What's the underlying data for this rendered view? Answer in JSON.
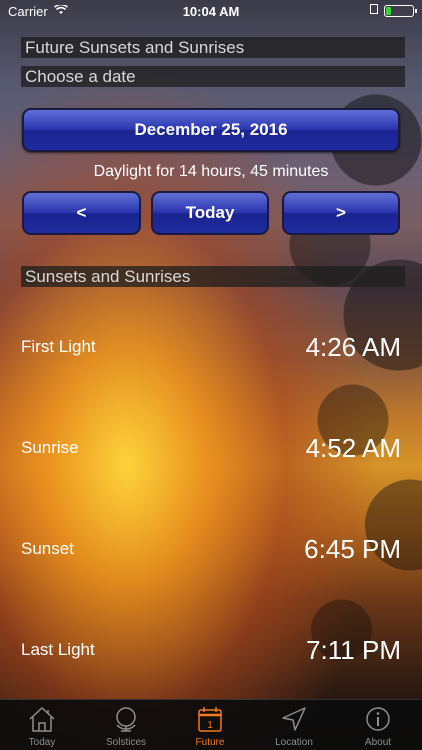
{
  "status": {
    "carrier": "Carrier",
    "time": "10:04 AM",
    "battery_level": 0.2
  },
  "headers": {
    "future": "Future Sunsets and Sunrises",
    "choose_date": "Choose a date",
    "sunsets": "Sunsets and Sunrises"
  },
  "date_button": "December 25, 2016",
  "daylight": "Daylight for 14 hours, 45 minutes",
  "nav": {
    "prev": "<",
    "today": "Today",
    "next": ">"
  },
  "rows": [
    {
      "label": "First Light",
      "time": "4:26 AM"
    },
    {
      "label": "Sunrise",
      "time": "4:52 AM"
    },
    {
      "label": "Sunset",
      "time": "6:45 PM"
    },
    {
      "label": "Last Light",
      "time": "7:11 PM"
    }
  ],
  "tabs": [
    {
      "label": "Today",
      "icon": "house-icon",
      "active": false
    },
    {
      "label": "Solstices",
      "icon": "globe-icon",
      "active": false
    },
    {
      "label": "Future",
      "icon": "calendar-icon",
      "calendar_day": "1",
      "active": true
    },
    {
      "label": "Location",
      "icon": "location-arrow-icon",
      "active": false
    },
    {
      "label": "About",
      "icon": "info-icon",
      "active": false
    }
  ],
  "colors": {
    "accent": "#f07a1b",
    "button": "#2b36b0"
  }
}
